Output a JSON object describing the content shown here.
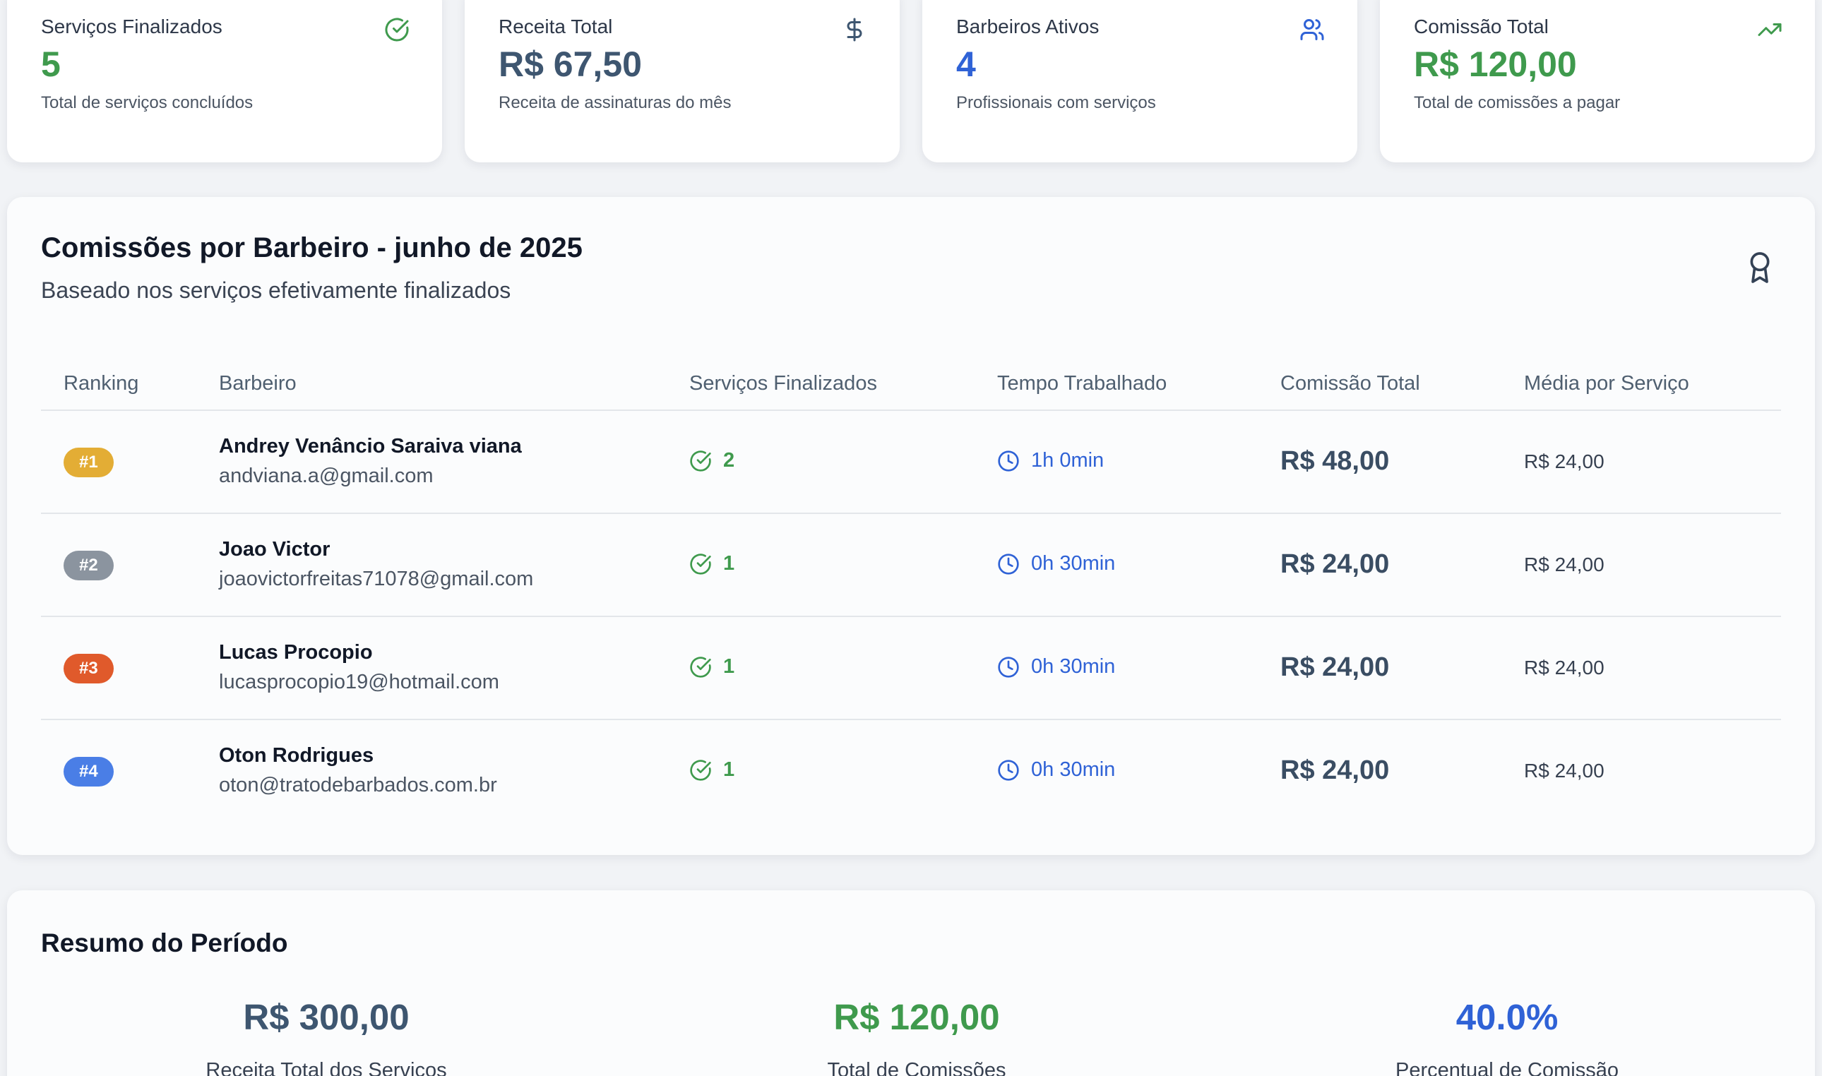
{
  "colors": {
    "green": "#3f9a4d",
    "slate": "#3e5670",
    "blue": "#2f62d6",
    "rank_gold": "#e3ad35",
    "rank_silver": "#8b949f",
    "rank_bronze": "#e05a2b",
    "rank_blue": "#4a7ee6"
  },
  "stats": [
    {
      "label": "Serviços Finalizados",
      "value": "5",
      "desc": "Total de serviços concluídos",
      "icon": "check-circle-icon"
    },
    {
      "label": "Receita Total",
      "value": "R$ 67,50",
      "desc": "Receita de assinaturas do mês",
      "icon": "dollar-icon"
    },
    {
      "label": "Barbeiros Ativos",
      "value": "4",
      "desc": "Profissionais com serviços",
      "icon": "users-icon"
    },
    {
      "label": "Comissão Total",
      "value": "R$ 120,00",
      "desc": "Total de comissões a pagar",
      "icon": "trending-up-icon"
    }
  ],
  "commissions": {
    "title": "Comissões por Barbeiro - junho de 2025",
    "subtitle": "Baseado nos serviços efetivamente finalizados",
    "icon": "award-icon",
    "headers": [
      "Ranking",
      "Barbeiro",
      "Serviços Finalizados",
      "Tempo Trabalhado",
      "Comissão Total",
      "Média por Serviço"
    ],
    "rows": [
      {
        "rank": "#1",
        "name": "Andrey Venâncio Saraiva viana",
        "email": "andviana.a@gmail.com",
        "services": "2",
        "time": "1h 0min",
        "commission": "R$ 48,00",
        "avg": "R$ 24,00"
      },
      {
        "rank": "#2",
        "name": "Joao Victor",
        "email": "joaovictorfreitas71078@gmail.com",
        "services": "1",
        "time": "0h 30min",
        "commission": "R$ 24,00",
        "avg": "R$ 24,00"
      },
      {
        "rank": "#3",
        "name": "Lucas Procopio",
        "email": "lucasprocopio19@hotmail.com",
        "services": "1",
        "time": "0h 30min",
        "commission": "R$ 24,00",
        "avg": "R$ 24,00"
      },
      {
        "rank": "#4",
        "name": "Oton Rodrigues",
        "email": "oton@tratodebarbados.com.br",
        "services": "1",
        "time": "0h 30min",
        "commission": "R$ 24,00",
        "avg": "R$ 24,00"
      }
    ]
  },
  "summary": {
    "title": "Resumo do Período",
    "items": [
      {
        "value": "R$ 300,00",
        "label": "Receita Total dos Serviços"
      },
      {
        "value": "R$ 120,00",
        "label": "Total de Comissões"
      },
      {
        "value": "40.0%",
        "label": "Percentual de Comissão"
      }
    ]
  }
}
